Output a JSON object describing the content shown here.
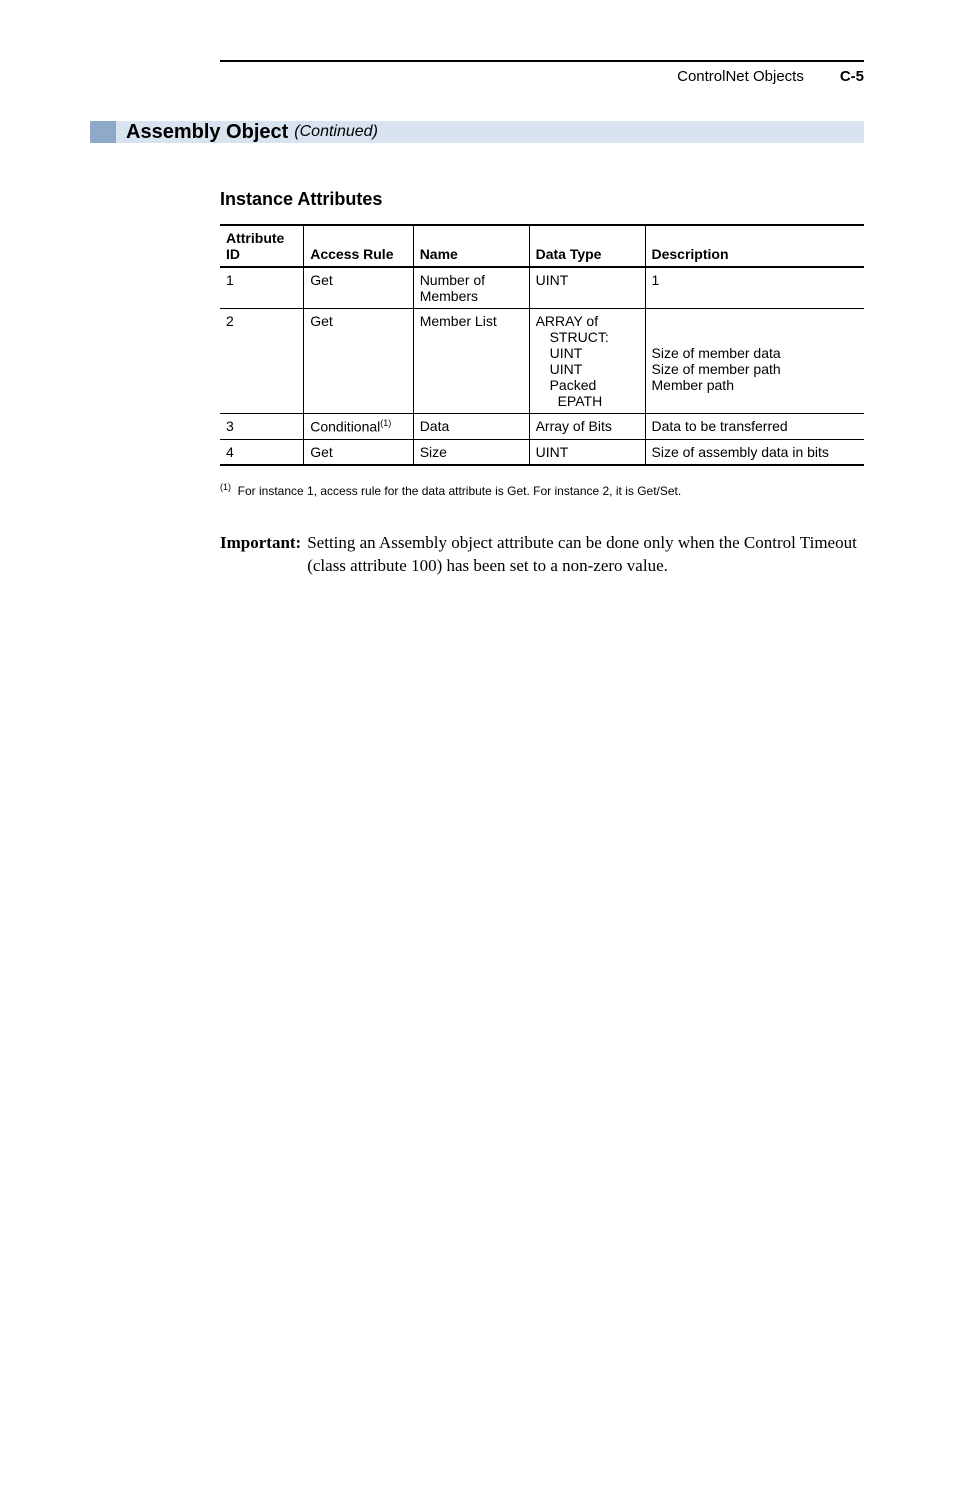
{
  "header": {
    "title": "ControlNet Objects",
    "page": "C-5"
  },
  "section": {
    "title": "Assembly Object",
    "continued": "(Continued)"
  },
  "subheading": "Instance Attributes",
  "table": {
    "headers": {
      "attr_id_l1": "Attribute",
      "attr_id_l2": "ID",
      "access": "Access Rule",
      "name": "Name",
      "data_type": "Data Type",
      "description": "Description"
    },
    "rows": [
      {
        "id": "1",
        "access": "Get",
        "name": "Number of Members",
        "type": "UINT",
        "desc": "1"
      },
      {
        "id": "2",
        "access": "Get",
        "name": "Member List",
        "type_l1": "ARRAY of",
        "type_l2": "STRUCT:",
        "type_l3": "UINT",
        "type_l4": "UINT",
        "type_l5": "Packed",
        "type_l6": "EPATH",
        "desc_l1": "",
        "desc_l2": "",
        "desc_l3": "Size of member data",
        "desc_l4": "Size of member path",
        "desc_l5": "Member path",
        "desc_l6": ""
      },
      {
        "id": "3",
        "access": "Conditional",
        "access_sup": "(1)",
        "name": "Data",
        "type": "Array of Bits",
        "desc": "Data to be transferred"
      },
      {
        "id": "4",
        "access": "Get",
        "name": "Size",
        "type": "UINT",
        "desc": "Size of assembly data in bits"
      }
    ]
  },
  "footnote": {
    "marker": "(1)",
    "text": "For instance 1, access rule for the data attribute is Get. For instance 2, it is Get/Set."
  },
  "important": {
    "label": "Important:",
    "text": "Setting an Assembly object attribute can be done only when the Control Timeout (class attribute 100) has been set to a non-zero value."
  }
}
